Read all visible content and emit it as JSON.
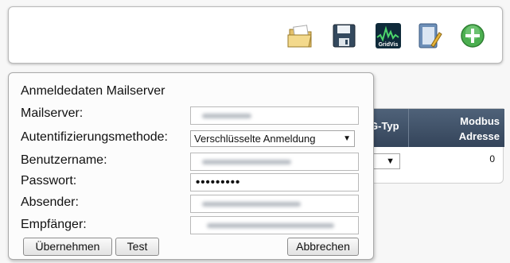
{
  "toolbar": {
    "icons": [
      "folder-open-icon",
      "save-icon",
      "gridvis-icon",
      "notepad-icon",
      "add-icon"
    ],
    "gridvis_text": "GridVis"
  },
  "table": {
    "col_typ": "G-Typ",
    "col_modbus_line1": "Modbus",
    "col_modbus_line2": "Adresse",
    "row_modbus_value": "0"
  },
  "dialog": {
    "title": "Anmeldedaten Mailserver",
    "labels": {
      "mailserver": "Mailserver:",
      "auth": "Autentifizierungsmethode:",
      "username": "Benutzername:",
      "password": "Passwort:",
      "sender": "Absender:",
      "recipient": "Empfänger:"
    },
    "auth_value": "Verschlüsselte Anmeldung",
    "password_mask": "•••••••••",
    "buttons": {
      "apply": "Übernehmen",
      "test": "Test",
      "cancel": "Abbrechen"
    }
  }
}
